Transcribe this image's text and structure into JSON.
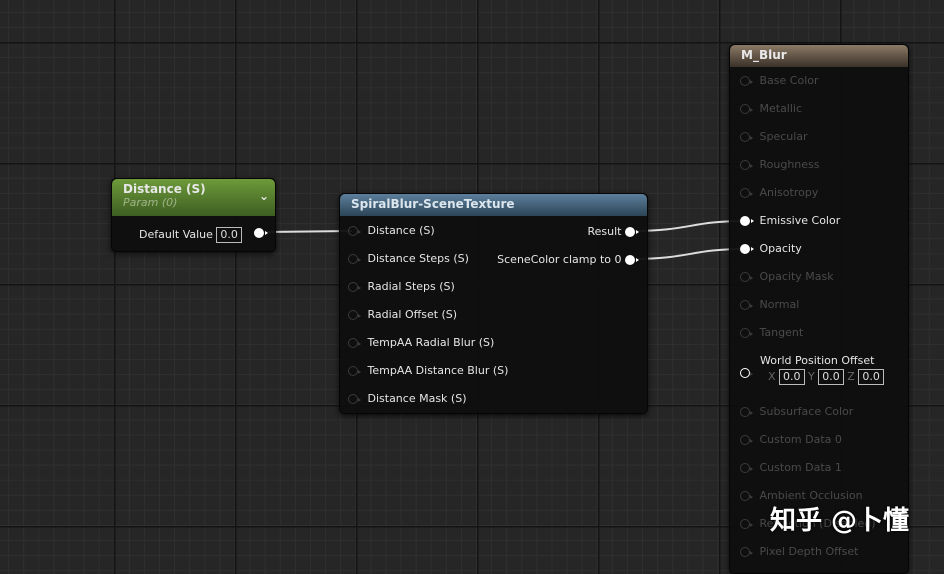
{
  "param_node": {
    "title": "Distance (S)",
    "subtitle": "Param (0)",
    "default_label": "Default Value",
    "default_value": "0.0"
  },
  "function_node": {
    "title": "SpiralBlur-SceneTexture",
    "inputs": [
      "Distance (S)",
      "Distance Steps (S)",
      "Radial Steps (S)",
      "Radial Offset (S)",
      "TempAA Radial Blur (S)",
      "TempAA Distance Blur (S)",
      "Distance Mask (S)"
    ],
    "outputs": [
      "Result",
      "SceneColor clamp to 0"
    ]
  },
  "material_node": {
    "title": "M_Blur",
    "pins": [
      "Base Color",
      "Metallic",
      "Specular",
      "Roughness",
      "Anisotropy",
      "Emissive Color",
      "Opacity",
      "Opacity Mask",
      "Normal",
      "Tangent"
    ],
    "wpo": {
      "label": "World Position Offset",
      "x_label": "X",
      "x": "0.0",
      "y_label": "Y",
      "y": "0.0",
      "z_label": "Z",
      "z": "0.0"
    },
    "pins2": [
      "Subsurface Color",
      "Custom Data 0",
      "Custom Data 1",
      "Ambient Occlusion",
      "Refraction (Disabled)",
      "Pixel Depth Offset"
    ]
  },
  "watermark": "知乎 @卜懂"
}
